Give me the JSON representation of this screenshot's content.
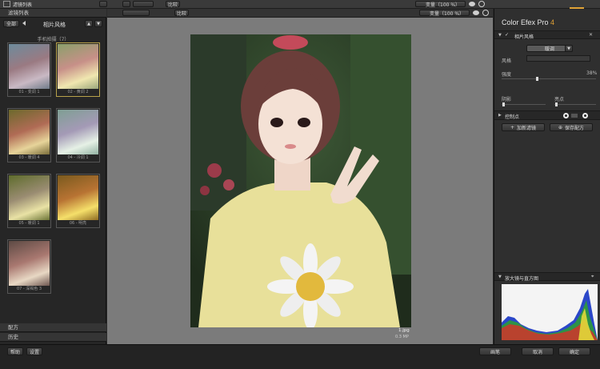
{
  "topbar": {
    "left_label": "滤镜列表",
    "center_label": "比较",
    "zoom_left": "变量（100 %）",
    "zoom_right": "变量（100 %）"
  },
  "left": {
    "tab_filters": "滤镜列表",
    "btn_all": "全部",
    "category": "相片风格",
    "group_title": "手机拍摄（7）",
    "thumbs": [
      {
        "label": "01 - 变调 1"
      },
      {
        "label": "02 - 黄调 2"
      },
      {
        "label": "03 - 暖调 4"
      },
      {
        "label": "04 - 冷调 1"
      },
      {
        "label": "05 - 暖调 1"
      },
      {
        "label": "06 - 明亮"
      },
      {
        "label": "07 - 深褐色 3"
      }
    ],
    "tab_recipe": "配方",
    "tab_history": "历史"
  },
  "center": {
    "filename": "1.jpg",
    "filesize": "0.3 MP"
  },
  "right": {
    "app_title": "Color Efex Pro",
    "app_version": "4",
    "filter_name": "相片风格",
    "style_label": "风格",
    "style_value": "暖调",
    "strength_label": "强度",
    "strength_value": "38%",
    "shadow_label": "阴影",
    "highlight_label": "亮点",
    "control_points_label": "控制点",
    "add_filter": "加新滤镜",
    "save_recipe": "保存配方",
    "histogram_label": "放大镜与直方图"
  },
  "bottom": {
    "help": "帮助",
    "settings": "设置",
    "brush": "画笔",
    "cancel": "取消",
    "ok": "确定"
  },
  "colors": {
    "accent": "#e0a235",
    "panel": "#262626"
  }
}
